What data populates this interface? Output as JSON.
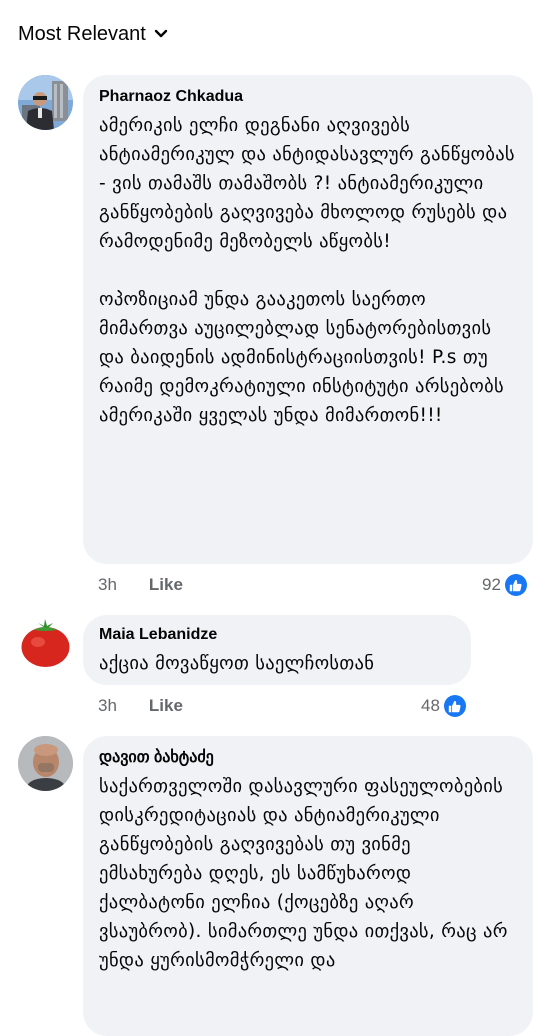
{
  "sort": {
    "label": "Most Relevant",
    "icon": "chevron-down-icon"
  },
  "comments": [
    {
      "author": "Pharnaoz Chkadua",
      "avatar": "profile-photo-man-with-sunglasses",
      "text": "ამერიკის ელჩი დეგნანი აღვივებს ანტიამერიკულ და ანტიდასავლურ განწყობას - ვის თამაშს თამაშობს ?! ანტიამერიკული განწყობების გაღვივება მხოლოდ რუსებს და რამოდენიმე მეზობელს აწყობს!\n\nოპოზიციამ უნდა გააკეთოს საერთო მიმართვა აუცილებლად სენატორებისთვის და ბაიდენის ადმინისტრაციისთვის! P.s თუ რაიმე დემოკრატიული ინსტიტუტი არსებობს ამერიკაში ყველას უნდა მიმართონ!!!",
      "time": "3h",
      "like_label": "Like",
      "reaction_count": "92"
    },
    {
      "author": "Maia Lebanidze",
      "avatar": "tomato-avatar",
      "text": "აქცია მოვაწყოთ საელჩოსთან",
      "time": "3h",
      "like_label": "Like",
      "reaction_count": "48"
    },
    {
      "author": "დავით ბახტაძე",
      "avatar": "profile-photo-bald-man",
      "text": "საქართველოში დასავლური ფასეულობების დისკრედიტაციას და ანტიამერიკული განწყობების გაღვივებას თუ ვინმე ემსახურება დღეს, ეს სამწუხაროდ ქალბატონი ელჩია (ქოცებზე აღარ ვსაუბრობ). სიმართლე უნდა ითქვას, რაც არ უნდა ყურისმომჭრელი და"
    }
  ],
  "colors": {
    "bubble": "#f0f2f5",
    "meta_text": "#65676b",
    "like_blue": "#1877f2"
  }
}
